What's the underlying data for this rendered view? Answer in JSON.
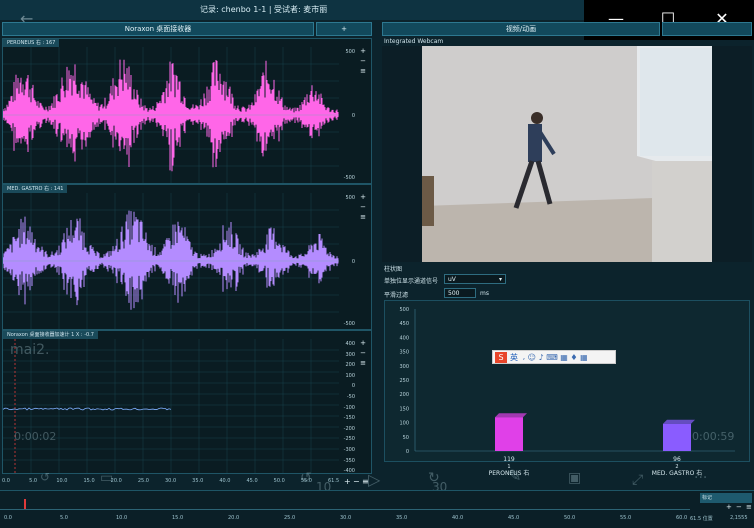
{
  "window": {
    "title": "记录: chenbo 1-1 | 受试者: 麦市丽",
    "minimize": "—",
    "maximize": "☐",
    "close": "✕"
  },
  "left_panel": {
    "header": "Noraxon 桌面接收器",
    "add_label": "+"
  },
  "right_panel": {
    "header": "视频/动画",
    "webcam_label": "Integrated Webcam"
  },
  "channels": [
    {
      "label": "PERONEUS 右 : 167",
      "scale_top": "500",
      "scale_mid": "0",
      "scale_bot": "-500",
      "color": "#ff66e8"
    },
    {
      "label": "MED. GASTRO 右 : 141",
      "scale_top": "500",
      "scale_mid": "0",
      "scale_bot": "-500",
      "color": "#b48cff"
    },
    {
      "label": "Noraxon 桌面接收器加速计 1 X : -0.7",
      "scale": [
        "400",
        "300",
        "200",
        "100",
        "0",
        "-50",
        "-100",
        "-150",
        "-200",
        "-250",
        "-300",
        "-350",
        "-400"
      ]
    }
  ],
  "axis_x_ticks": [
    "0.0",
    "5.0",
    "10.0",
    "15.0",
    "20.0",
    "25.0",
    "30.0",
    "35.0",
    "40.0",
    "45.0",
    "50.0",
    "55.0",
    "61.5"
  ],
  "bar_section": {
    "title": "柱状图",
    "unit_label": "单独位显示通道信号",
    "unit_value": "uV",
    "avg_label": "平滑过滤",
    "avg_value": "500",
    "avg_unit": "ms",
    "y_ticks": [
      "500",
      "450",
      "400",
      "350",
      "300",
      "250",
      "200",
      "150",
      "100",
      "50",
      "0"
    ]
  },
  "chart_data": {
    "type": "bar",
    "categories": [
      "PERONEUS 右",
      "MED. GASTRO 右"
    ],
    "values": [
      119,
      96
    ],
    "index": [
      "1",
      "2"
    ],
    "ylim": [
      0,
      500
    ],
    "colors": [
      "#e040e8",
      "#8a5cff"
    ]
  },
  "overlay": {
    "ime_label": "英",
    "name_text": "mai2.",
    "time_left": "0:00:02",
    "time_right": "0:00:59",
    "skip_back": "10",
    "skip_fwd": "30"
  },
  "timeline": {
    "ticks": [
      "0.0",
      "5.0",
      "10.0",
      "15.0",
      "20.0",
      "25.0",
      "30.0",
      "35.0",
      "40.0",
      "45.0",
      "50.0",
      "55.0",
      "60.0"
    ],
    "end_label": "61.5 位置",
    "end_value": "2,1555",
    "mark_label": "标记"
  }
}
